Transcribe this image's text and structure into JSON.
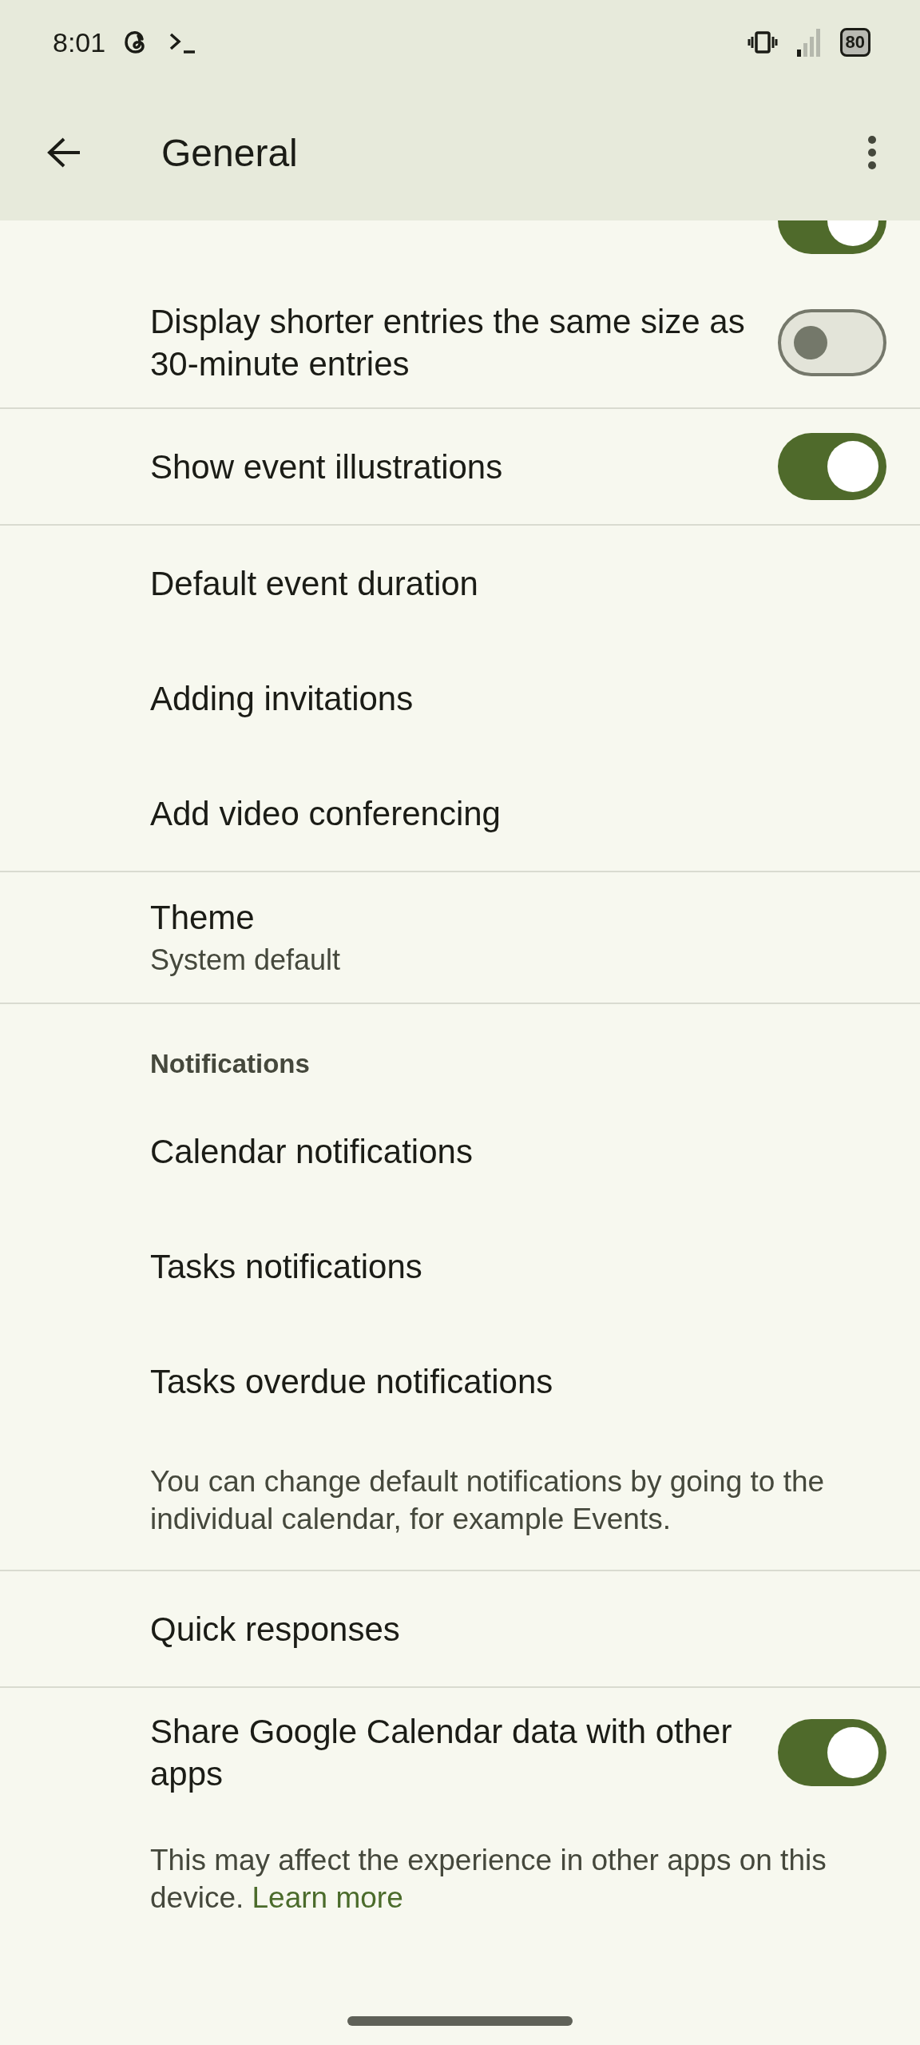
{
  "status_bar": {
    "time": "8:01",
    "battery": "80"
  },
  "app_bar": {
    "title": "General"
  },
  "sections": [
    {
      "items": [
        {
          "kind": "toggle",
          "on": true
        },
        {
          "kind": "toggle",
          "label": "Display shorter entries the same size as 30-minute entries",
          "on": false
        }
      ]
    },
    {
      "items": [
        {
          "kind": "toggle",
          "label": "Show event illustrations",
          "on": true
        }
      ]
    },
    {
      "items": [
        {
          "kind": "link",
          "label": "Default event duration"
        },
        {
          "kind": "link",
          "label": "Adding invitations"
        },
        {
          "kind": "link",
          "label": "Add video conferencing"
        }
      ]
    },
    {
      "items": [
        {
          "kind": "link",
          "label": "Theme",
          "subtitle": "System default"
        }
      ]
    },
    {
      "items": [
        {
          "kind": "header",
          "label": "Notifications"
        },
        {
          "kind": "link",
          "label": "Calendar notifications"
        },
        {
          "kind": "link",
          "label": "Tasks notifications"
        },
        {
          "kind": "link",
          "label": "Tasks overdue notifications"
        },
        {
          "kind": "note",
          "label": "You can change default notifications by going to the individual calendar, for example Events."
        }
      ]
    },
    {
      "items": [
        {
          "kind": "link",
          "label": "Quick responses"
        }
      ]
    },
    {
      "items": [
        {
          "kind": "toggle",
          "label": "Share Google Calendar data with other apps",
          "on": true
        },
        {
          "kind": "note",
          "label": "This may affect the experience in other apps on this device.",
          "link": "Learn more"
        }
      ]
    }
  ]
}
